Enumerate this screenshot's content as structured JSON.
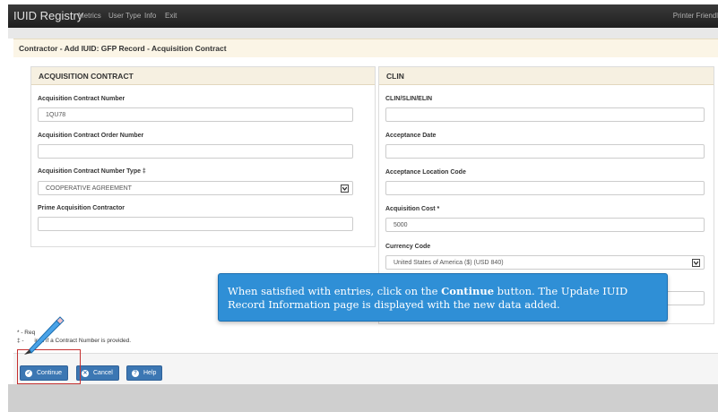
{
  "navbar": {
    "brand": "IUID Registry",
    "items": [
      "Metrics",
      "User Type",
      "Info",
      "Exit"
    ],
    "printer_friendly": "Printer Friendl"
  },
  "page_title": "Contractor - Add IUID: GFP Record - Acquisition Contract",
  "acquisition": {
    "heading": "ACQUISITION CONTRACT",
    "contract_number_label": "Acquisition Contract Number",
    "contract_number_value": "1QU78",
    "order_number_label": "Acquisition Contract Order Number",
    "order_number_value": "",
    "type_label": "Acquisition Contract Number Type ‡",
    "type_value": "COOPERATIVE AGREEMENT",
    "prime_label": "Prime Acquisition Contractor",
    "prime_value": ""
  },
  "clin": {
    "heading": "CLIN",
    "clin_label": "CLIN/SLIN/ELIN",
    "acceptance_date_label": "Acceptance Date",
    "acceptance_location_label": "Acceptance Location Code",
    "cost_label": "Acquisition Cost *",
    "cost_value": "5000",
    "currency_label": "Currency Code",
    "currency_value": "United States of America ($) (USD 840)"
  },
  "notes": {
    "required_partial": "* - Req",
    "conditional_partial": "‡ - ",
    "conditional_rest": "ired if a Contract Number is provided."
  },
  "buttons": {
    "continue": "Continue",
    "cancel": "Cancel",
    "help": "Help"
  },
  "tooltip": {
    "part1": "When satisfied with entries, click on the ",
    "bold": "Continue",
    "part2": " button. The Update IUID Record Information page is displayed with the new data added."
  },
  "colors": {
    "navbar": "#2a2a2a",
    "panel_header": "#f6f0e1",
    "button": "#3c77b3",
    "tooltip": "#2f8fd6",
    "highlight": "#c53030"
  },
  "icons": {
    "continue": "check-circle-icon",
    "cancel": "x-circle-icon",
    "help": "question-circle-icon",
    "pencil": "pencil-icon"
  }
}
